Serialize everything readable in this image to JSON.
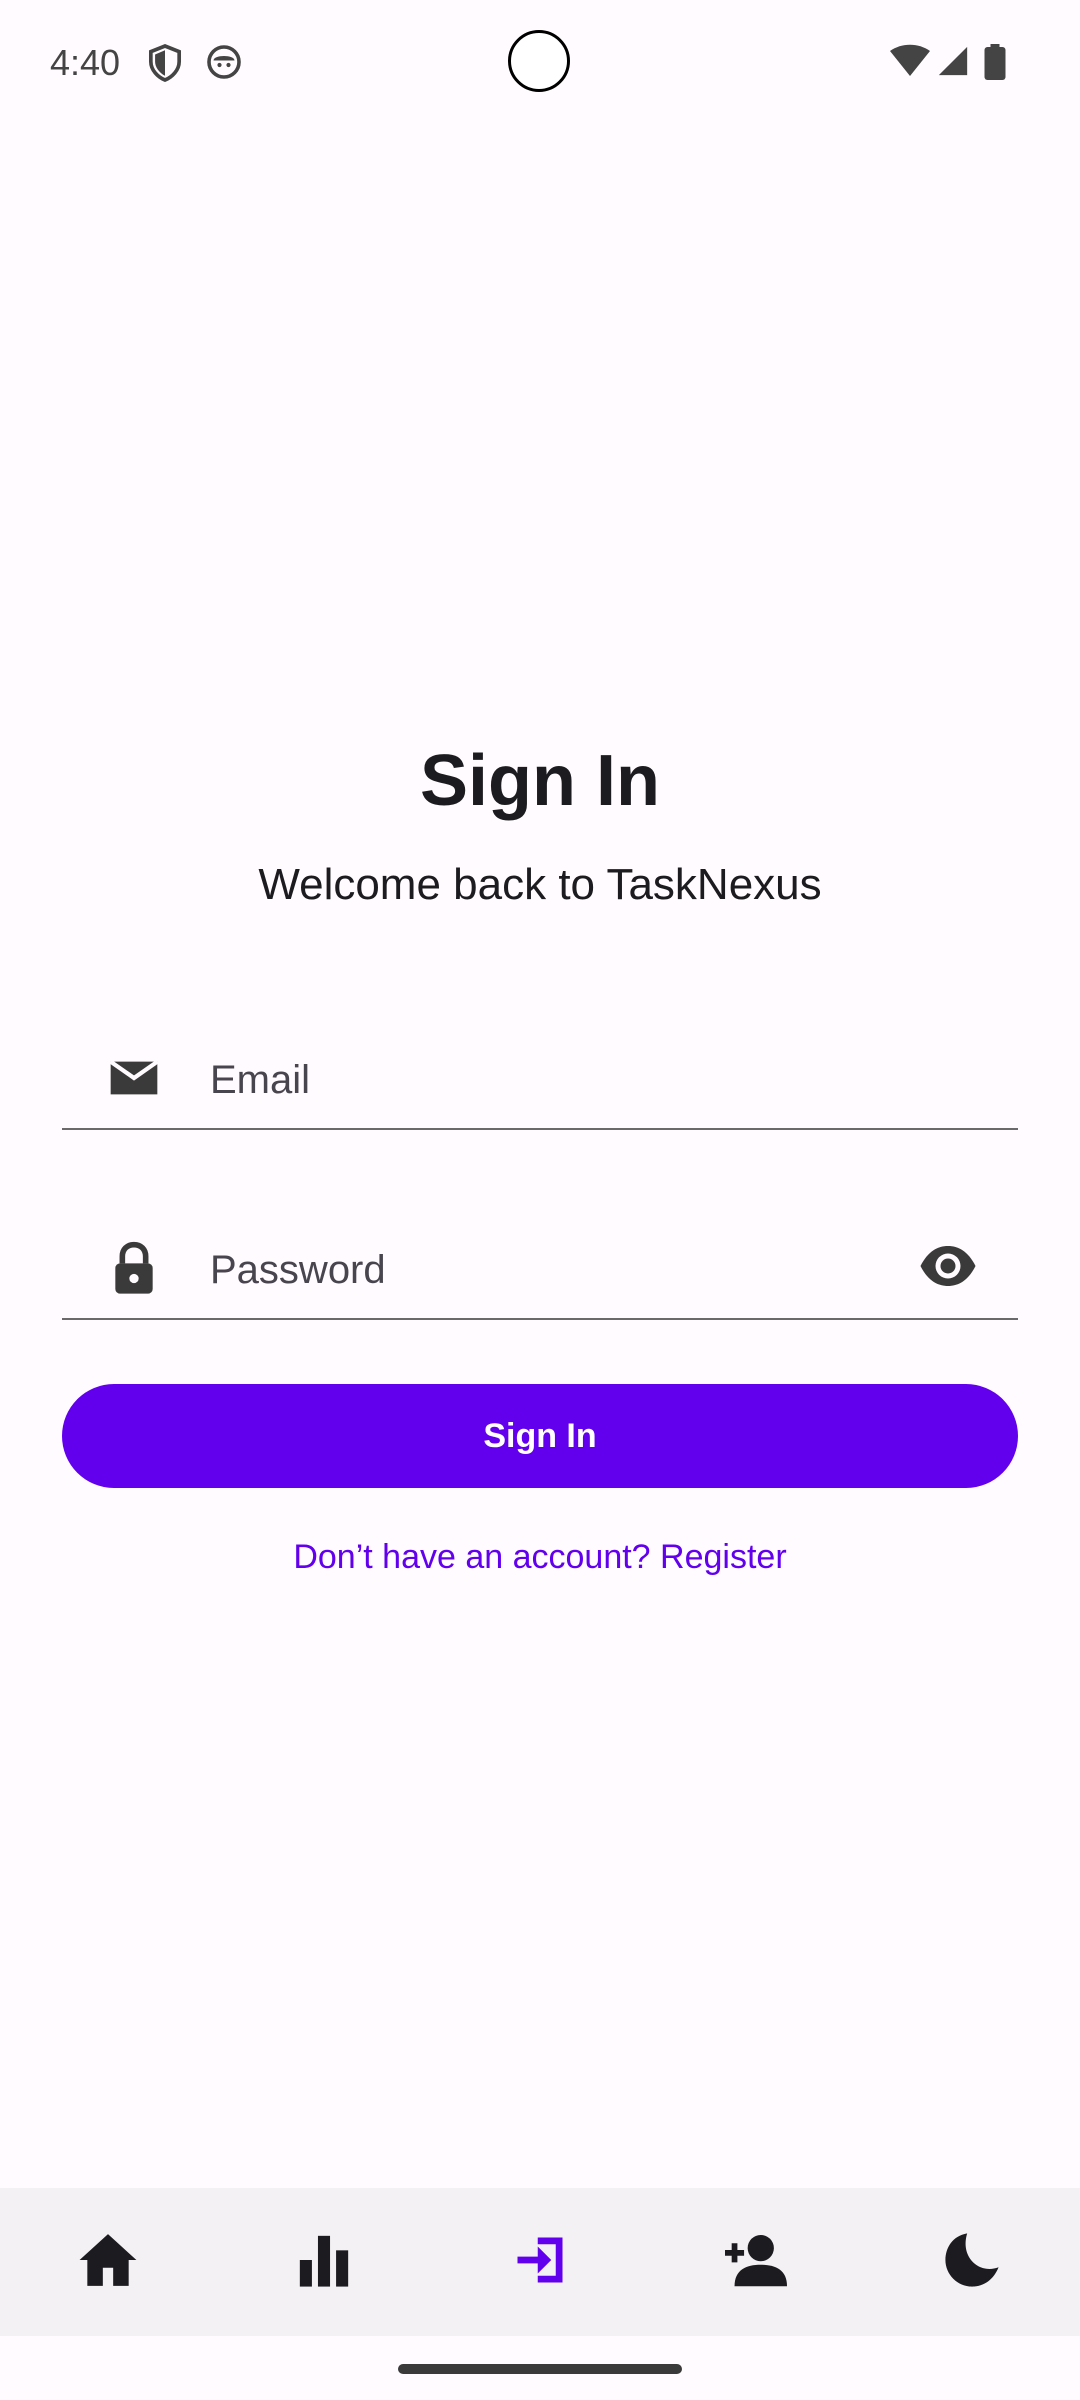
{
  "status_bar": {
    "time": "4:40",
    "icons": [
      "shield-icon",
      "android-face-icon",
      "wifi-icon",
      "cell-signal-icon",
      "battery-icon"
    ]
  },
  "header": {
    "title": "Sign In",
    "subtitle": "Welcome back to TaskNexus"
  },
  "form": {
    "email_placeholder": "Email",
    "password_placeholder": "Password",
    "submit_label": "Sign In",
    "register_link": "Don’t have an account? Register"
  },
  "nav": {
    "items": [
      "home-icon",
      "stats-icon",
      "login-icon",
      "add-person-icon",
      "dark-mode-icon"
    ],
    "active": "login-icon"
  },
  "colors": {
    "accent": "#6200ee",
    "background": "#fffbfe",
    "nav_background": "#f3f1f4",
    "icon": "#1c1b1f"
  }
}
